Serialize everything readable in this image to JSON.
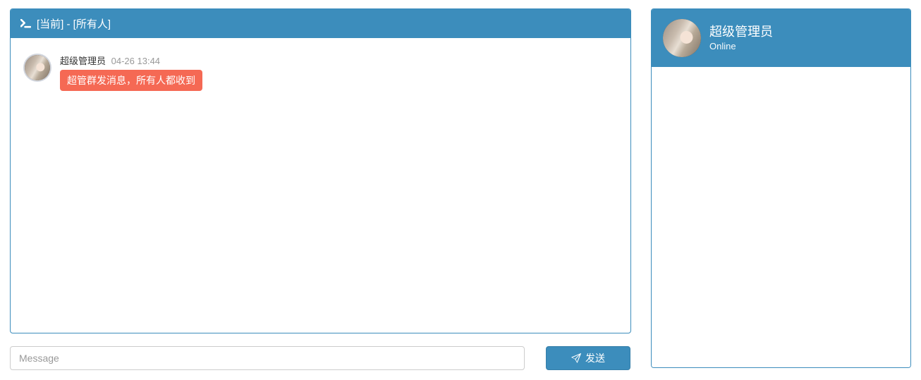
{
  "chat": {
    "header_title": "[当前] - [所有人]",
    "messages": [
      {
        "sender": "超级管理员",
        "time": "04-26 13:44",
        "text": "超管群发消息，所有人都收到"
      }
    ]
  },
  "composer": {
    "placeholder": "Message",
    "send_label": "发送"
  },
  "sidebar": {
    "user_name": "超级管理员",
    "status": "Online"
  }
}
